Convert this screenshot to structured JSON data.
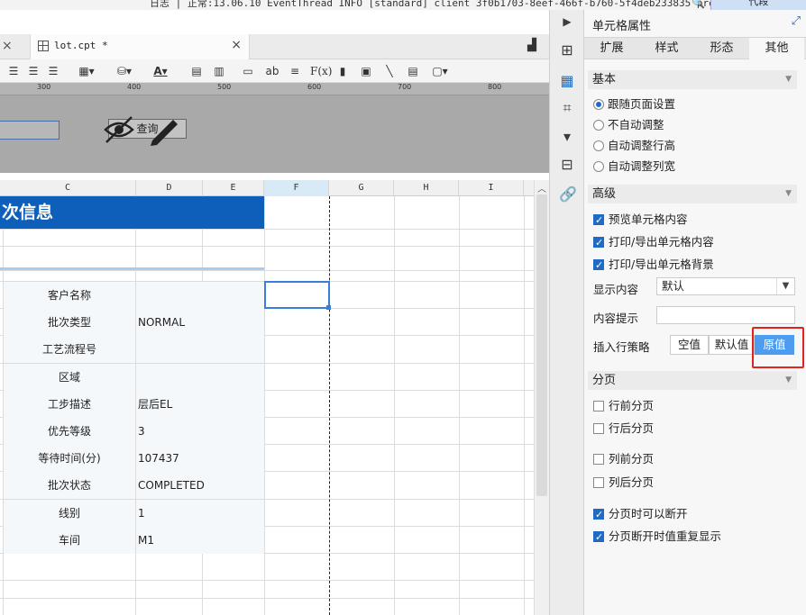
{
  "logbar": {
    "text": "日志 | 正常:13.06.10 EventThread INFO [standard] client 3f0b1703-8eef-466f-b760-5f4deb233835 pro1...",
    "field_button": "代段"
  },
  "tabbar": {
    "tab_title": "lot.cpt *",
    "close_symbol": "×"
  },
  "ruler": {
    "labels": [
      "300",
      "400",
      "500",
      "600",
      "700",
      "800"
    ]
  },
  "params": {
    "query_label": "查询"
  },
  "sheet": {
    "columns": [
      "C",
      "D",
      "E",
      "F",
      "G",
      "H",
      "I"
    ],
    "title": "次信息",
    "rows": [
      {
        "label": "客户名称",
        "value": ""
      },
      {
        "label": "批次类型",
        "value": "NORMAL"
      },
      {
        "label": "工艺流程号",
        "value": ""
      },
      {
        "label": "区域",
        "value": ""
      },
      {
        "label": "工步描述",
        "value": "层后EL"
      },
      {
        "label": "优先等级",
        "value": "3"
      },
      {
        "label": "等待时间(分)",
        "value": "107437"
      },
      {
        "label": "批次状态",
        "value": "COMPLETED"
      },
      {
        "label": "线别",
        "value": "1"
      },
      {
        "label": "车间",
        "value": "M1"
      }
    ]
  },
  "panel": {
    "title": "单元格属性",
    "tabs": [
      "扩展",
      "样式",
      "形态",
      "其他"
    ],
    "active_tab": "其他",
    "basic": {
      "title": "基本",
      "options": [
        "跟随页面设置",
        "不自动调整",
        "自动调整行高",
        "自动调整列宽"
      ],
      "selected": "跟随页面设置"
    },
    "advanced": {
      "title": "高级",
      "checks": [
        "预览单元格内容",
        "打印/导出单元格内容",
        "打印/导出单元格背景"
      ],
      "display_label": "显示内容",
      "display_value": "默认",
      "tip_label": "内容提示",
      "tip_value": "",
      "insert_label": "插入行策略",
      "insert_options": [
        "空值",
        "默认值",
        "原值"
      ],
      "insert_selected": "原值"
    },
    "paging": {
      "title": "分页",
      "checks": [
        {
          "label": "行前分页",
          "checked": false
        },
        {
          "label": "行后分页",
          "checked": false
        },
        {
          "label": "列前分页",
          "checked": false
        },
        {
          "label": "列后分页",
          "checked": false
        },
        {
          "label": "分页时可以断开",
          "checked": true
        },
        {
          "label": "分页断开时值重复显示",
          "checked": true
        }
      ]
    }
  },
  "colors": {
    "title_banner": "#0e5fb9",
    "selected_border": "#3a7fd6",
    "active_segment": "#4d9cf0",
    "highlight": "#e0231f"
  }
}
